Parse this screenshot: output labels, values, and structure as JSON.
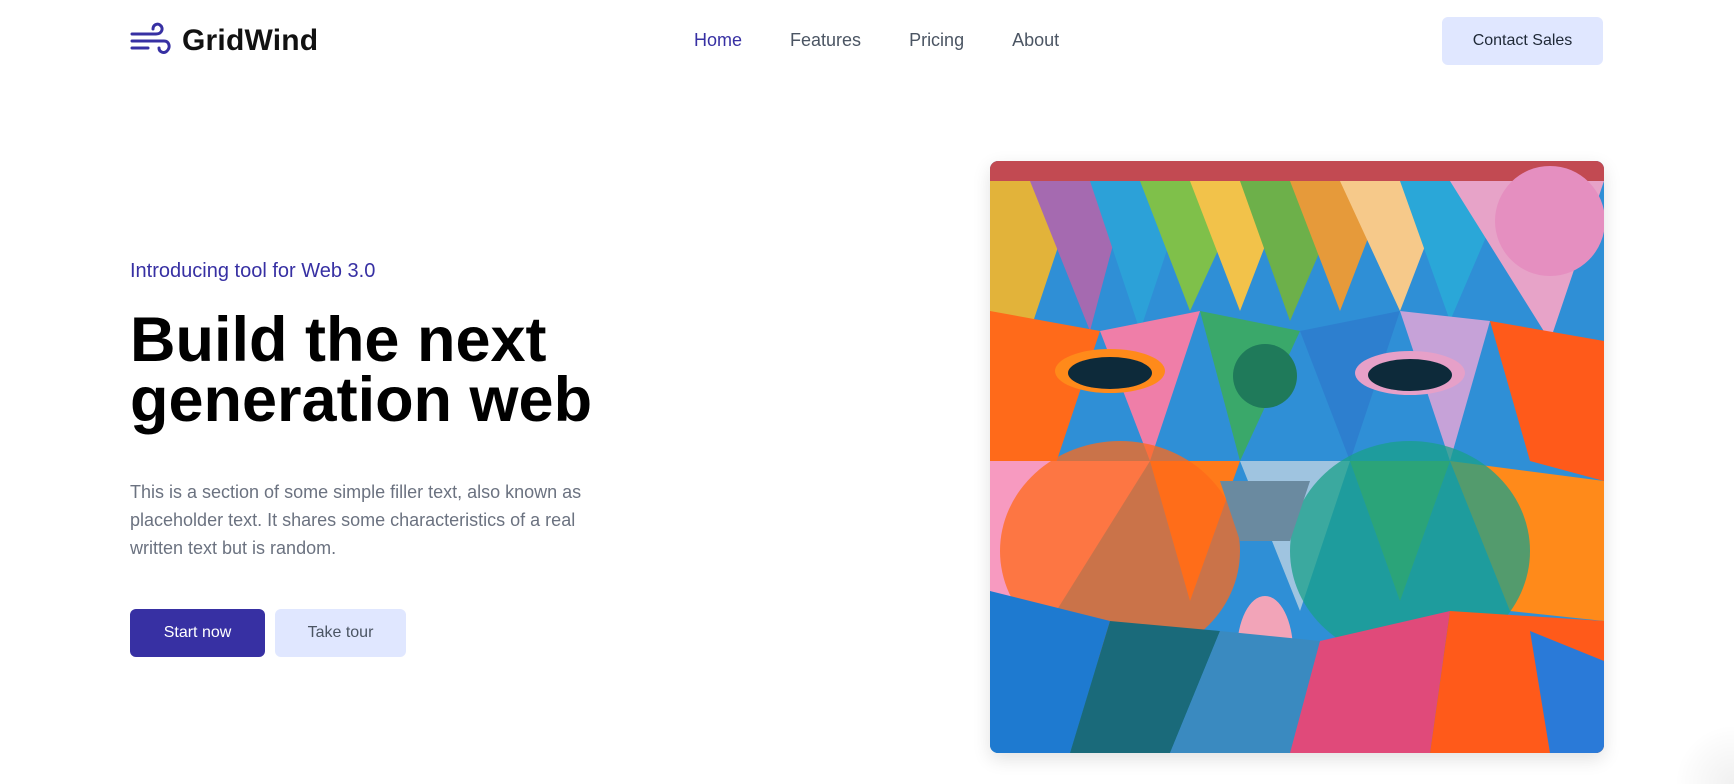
{
  "brand": {
    "name": "GridWind",
    "icon": "wind-icon",
    "accent": "#3730a3",
    "accent_light": "#e0e7ff"
  },
  "nav": {
    "items": [
      {
        "label": "Home",
        "active": true
      },
      {
        "label": "Features",
        "active": false
      },
      {
        "label": "Pricing",
        "active": false
      },
      {
        "label": "About",
        "active": false
      }
    ]
  },
  "header": {
    "contact_label": "Contact Sales"
  },
  "hero": {
    "eyebrow": "Introducing tool for Web 3.0",
    "headline_line1": "Build the next",
    "headline_line2": "generation web",
    "lead": "This is a section of some simple filler text, also known as placeholder text. It shares some characteristics of a real written text but is random.",
    "primary_label": "Start now",
    "secondary_label": "Take tour",
    "image": "colorful-geometric-mural-image"
  }
}
